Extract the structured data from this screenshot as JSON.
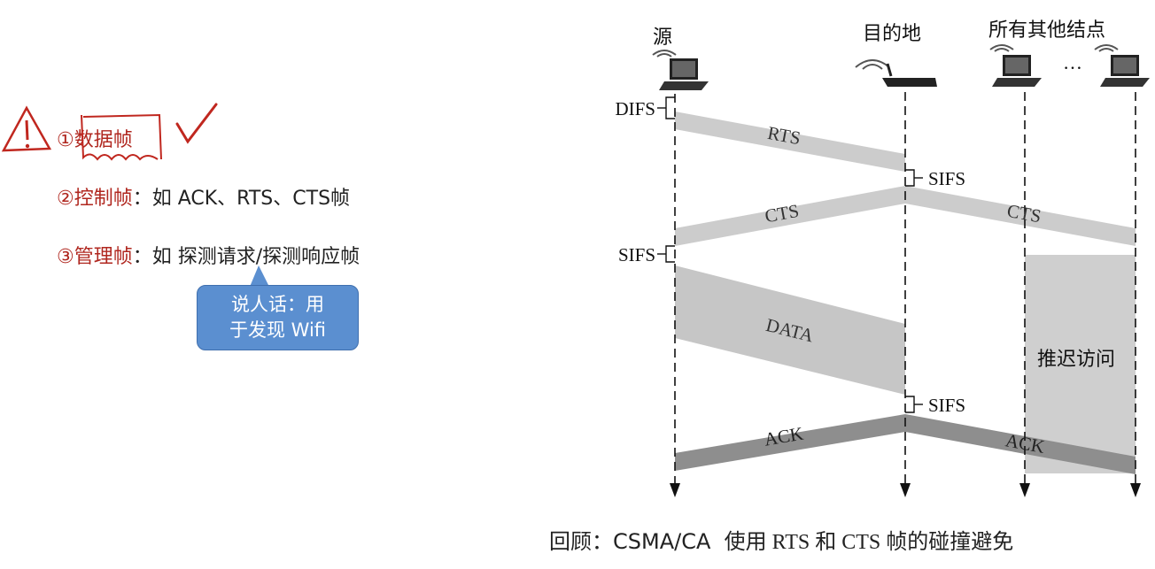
{
  "left_panel": {
    "items": [
      {
        "label": "①数据帧",
        "detail": ""
      },
      {
        "label": "②控制帧",
        "detail": "：如 ACK、RTS、CTS帧"
      },
      {
        "label": "③管理帧",
        "detail": "：如 探测请求/探测响应帧"
      }
    ],
    "callout": {
      "line1": "说人话：用",
      "line2": "于发现 Wifi"
    }
  },
  "diagram": {
    "nodes": {
      "source": "源",
      "destination": "目的地",
      "others": "所有其他结点",
      "ellipsis": "…"
    },
    "intervals": {
      "difs": "DIFS",
      "sifs_left": "SIFS",
      "sifs_dest_1": "SIFS",
      "sifs_dest_2": "SIFS"
    },
    "frames": {
      "rts": "RTS",
      "cts_left": "CTS",
      "cts_right": "CTS",
      "data": "DATA",
      "ack_left": "ACK",
      "ack_right": "ACK"
    },
    "defer": "推迟访问"
  },
  "footer": {
    "prefix": "回顾：CSMA/CA",
    "text": "使用 RTS 和 CTS 帧的碰撞避免"
  }
}
